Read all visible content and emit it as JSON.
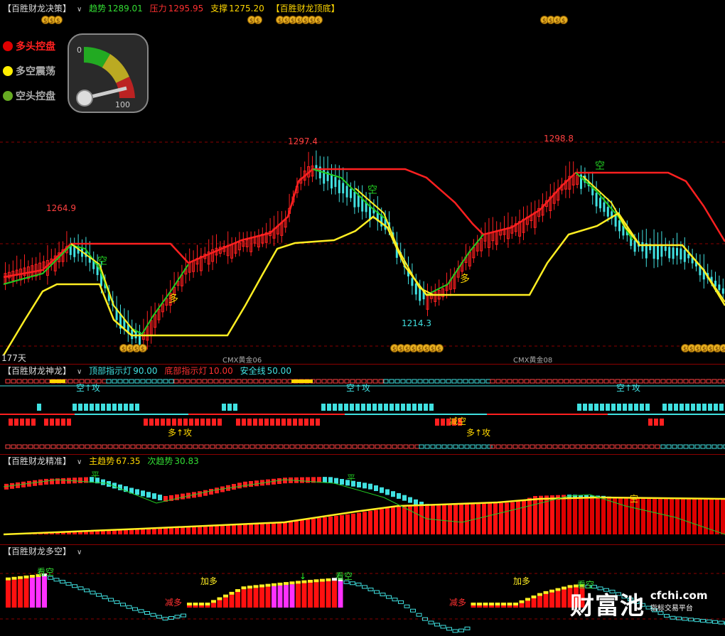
{
  "panel1": {
    "title": "【百胜财龙决策】",
    "trend_label": "趋势",
    "trend_value": "1289.01",
    "press_label": "压力",
    "press_value": "1295.95",
    "support_label": "支撑",
    "support_value": "1275.20",
    "sub_title": "【百胜财龙顶底】",
    "legend": [
      {
        "label": "多头控盘",
        "color": "#e00000"
      },
      {
        "label": "多空震荡",
        "color": "#ffee00"
      },
      {
        "label": "空头控盘",
        "color": "#66aa22"
      }
    ],
    "gauge_min": "0",
    "gauge_max": "100",
    "price_labels": [
      "1264.9",
      "1297.4",
      "1298.8",
      "1214.3"
    ],
    "signal_kong": "空",
    "signal_duo": "多",
    "days_label": "177天",
    "contract_labels": [
      "CMX黄金06",
      "CMX黄金08"
    ],
    "coin_glyph": "$$$"
  },
  "panel2": {
    "title": "【百胜财龙神龙】",
    "top_label": "顶部指示灯",
    "top_value": "90.00",
    "bottom_label": "底部指示灯",
    "bottom_value": "10.00",
    "safe_label": "安全线",
    "safe_value": "50.00",
    "kong_attack": "空↑攻",
    "duo_attack": "多↑攻",
    "reduce_kong": "减空"
  },
  "panel3": {
    "title": "【百胜财龙精准】",
    "main_label": "主趋势",
    "main_value": "67.35",
    "sub_label": "次趋势",
    "sub_value": "30.83",
    "ping": "平",
    "kong": "空"
  },
  "panel4": {
    "title": "【百胜财龙多空】",
    "kan_kong": "看空",
    "jian_duo": "减多",
    "jia_duo": "加多"
  },
  "watermark": {
    "brand": "财富池",
    "domain": "cfchi.com",
    "tagline": "指标交易平台"
  },
  "colors": {
    "red": "#ff2020",
    "cyan": "#40e0e0",
    "yellow": "#ffee22",
    "green": "#22cc22",
    "magenta": "#ff33ff"
  }
}
